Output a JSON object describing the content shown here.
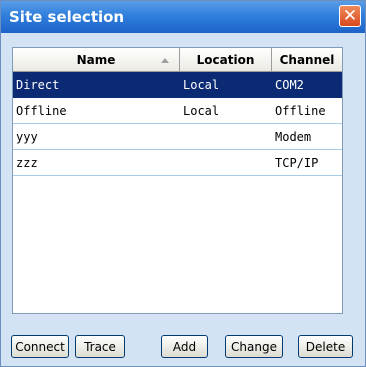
{
  "window": {
    "title": "Site selection",
    "close_symbol": "✕"
  },
  "table": {
    "columns": [
      "Name",
      "Location",
      "Channel"
    ],
    "sort_column": "Name",
    "rows": [
      {
        "name": "Direct",
        "location": "Local",
        "channel": "COM2",
        "selected": true
      },
      {
        "name": "Offline",
        "location": "Local",
        "channel": "Offline",
        "selected": false
      },
      {
        "name": "yyy",
        "location": "",
        "channel": "Modem",
        "selected": false
      },
      {
        "name": "zzz",
        "location": "",
        "channel": "TCP/IP",
        "selected": false
      }
    ]
  },
  "buttons": {
    "connect": "Connect",
    "trace": "Trace",
    "add": "Add",
    "change": "Change",
    "delete": "Delete"
  },
  "colors": {
    "title_bar": "#2f7fdd",
    "selection": "#0b2a73",
    "dialog_background": "#d4e3f3"
  }
}
